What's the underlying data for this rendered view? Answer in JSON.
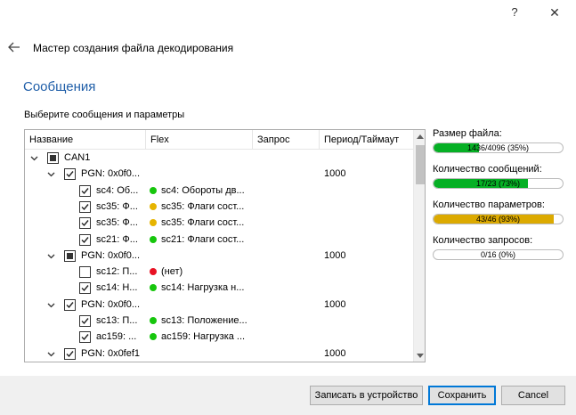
{
  "window": {
    "help_label": "?",
    "close_label": "✕"
  },
  "header": {
    "title": "Мастер создания файла декодирования"
  },
  "section": {
    "title": "Сообщения",
    "subtitle": "Выберите сообщения и параметры"
  },
  "tree": {
    "columns": {
      "name": "Название",
      "flex": "Flex",
      "request": "Запрос",
      "period": "Период/Таймаут"
    },
    "rows": [
      {
        "level": 0,
        "expanded": true,
        "check": "partial",
        "name": "CAN1",
        "flex": "",
        "dot": "",
        "period": ""
      },
      {
        "level": 1,
        "expanded": true,
        "check": "checked",
        "name": "PGN: 0x0f0...",
        "flex": "",
        "dot": "",
        "period": "1000"
      },
      {
        "level": 2,
        "check": "checked",
        "name": "sc4: Об...",
        "flex": "sc4: Обороты дв...",
        "dot": "green",
        "period": ""
      },
      {
        "level": 2,
        "check": "checked",
        "name": "sc35: Ф...",
        "flex": "sc35: Флаги сост...",
        "dot": "yellow",
        "period": ""
      },
      {
        "level": 2,
        "check": "checked",
        "name": "sc35: Ф...",
        "flex": "sc35: Флаги сост...",
        "dot": "yellow",
        "period": ""
      },
      {
        "level": 2,
        "check": "checked",
        "name": "sc21: Ф...",
        "flex": "sc21: Флаги сост...",
        "dot": "green",
        "period": ""
      },
      {
        "level": 1,
        "expanded": true,
        "check": "partial",
        "name": "PGN: 0x0f0...",
        "flex": "",
        "dot": "",
        "period": "1000"
      },
      {
        "level": 2,
        "check": "unchecked",
        "name": "sc12: П...",
        "flex": "(нет)",
        "dot": "red",
        "period": ""
      },
      {
        "level": 2,
        "check": "checked",
        "name": "sc14: Н...",
        "flex": "sc14: Нагрузка н...",
        "dot": "green",
        "period": ""
      },
      {
        "level": 1,
        "expanded": true,
        "check": "checked",
        "name": "PGN: 0x0f0...",
        "flex": "",
        "dot": "",
        "period": "1000"
      },
      {
        "level": 2,
        "check": "checked",
        "name": "sc13: П...",
        "flex": "sc13: Положение...",
        "dot": "green",
        "period": ""
      },
      {
        "level": 2,
        "check": "checked",
        "name": "ac159: ...",
        "flex": "ac159: Нагрузка ...",
        "dot": "green",
        "period": ""
      },
      {
        "level": 1,
        "expanded": true,
        "check": "checked",
        "name": "PGN: 0x0fef1",
        "flex": "",
        "dot": "",
        "period": "1000"
      }
    ]
  },
  "stats": [
    {
      "label": "Размер файла:",
      "text": "1436/4096 (35%)",
      "fraction": 0.35,
      "color": "#06b025"
    },
    {
      "label": "Количество сообщений:",
      "text": "17/23 (73%)",
      "fraction": 0.73,
      "color": "#06b025"
    },
    {
      "label": "Количество параметров:",
      "text": "43/46 (93%)",
      "fraction": 0.93,
      "color": "#dcaa00"
    },
    {
      "label": "Количество запросов:",
      "text": "0/16 (0%)",
      "fraction": 0.0,
      "color": "#06b025"
    }
  ],
  "dot_colors": {
    "green": "#16c60c",
    "yellow": "#e6b400",
    "red": "#e81123"
  },
  "footer": {
    "write_label": "Записать в устройство",
    "save_label": "Сохранить",
    "cancel_label": "Cancel"
  }
}
